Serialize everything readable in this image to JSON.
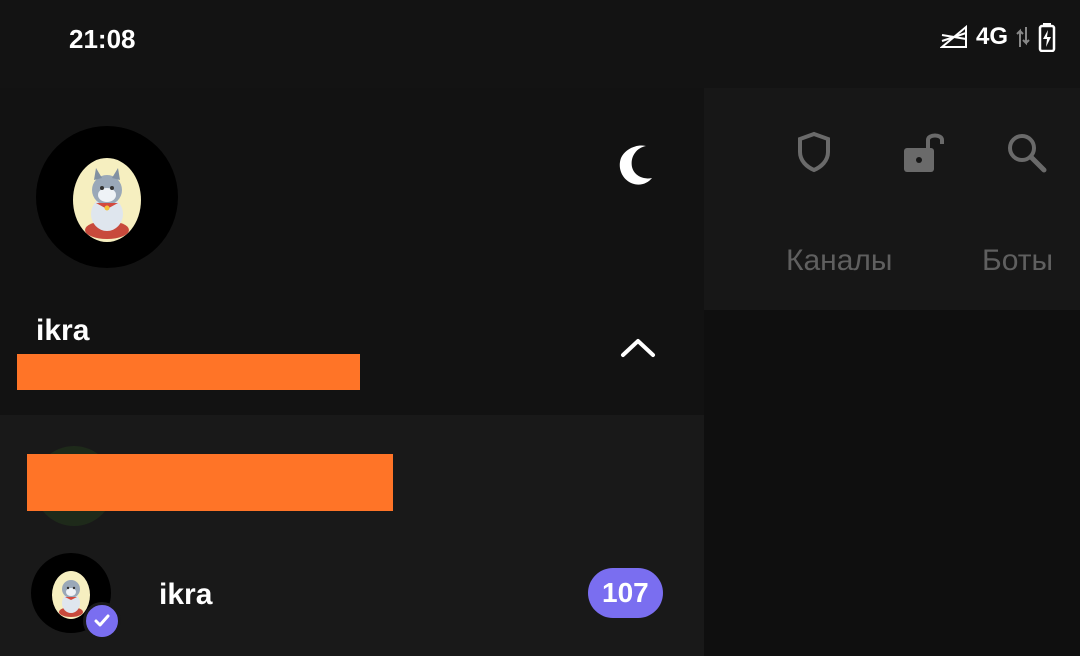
{
  "status_bar": {
    "time": "21:08",
    "network": "4G",
    "icons": [
      "signal-icon",
      "data-arrows-icon",
      "battery-charging-icon"
    ]
  },
  "background_app": {
    "toolbar_icons": [
      "shield-icon",
      "unlock-icon",
      "search-icon"
    ],
    "tabs": [
      {
        "label": "Каналы"
      },
      {
        "label": "Боты"
      }
    ]
  },
  "drawer": {
    "header": {
      "user_name": "ikra",
      "theme_toggle_icon": "moon-icon",
      "expand_icon": "chevron-up-icon"
    },
    "accounts": [
      {
        "name": "",
        "redacted": true
      },
      {
        "name": "ikra",
        "unread": "107",
        "active": true
      }
    ]
  },
  "colors": {
    "accent": "#7a6ef0",
    "redaction": "#ff7427",
    "drawer_header_bg": "#121212",
    "drawer_bg": "#191919"
  }
}
